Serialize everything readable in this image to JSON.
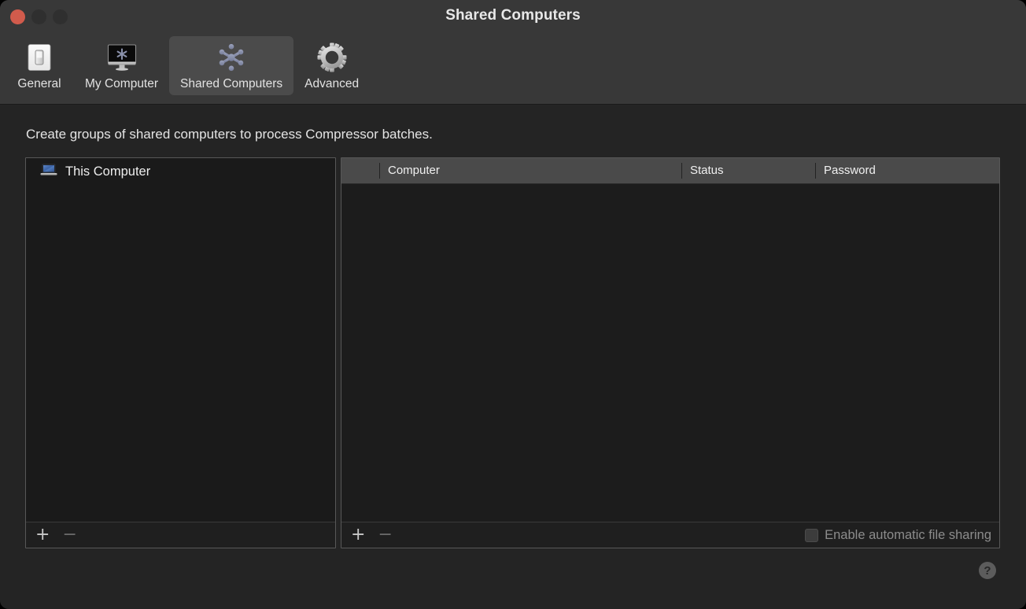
{
  "window": {
    "title": "Shared Computers",
    "traffic_lights": [
      {
        "name": "close",
        "color": "#d15b4c"
      },
      {
        "name": "minimize",
        "color": "#2f2f2f"
      },
      {
        "name": "zoom",
        "color": "#2f2f2f"
      }
    ]
  },
  "toolbar": {
    "tabs": [
      {
        "label": "General",
        "icon": "light-switch-icon",
        "selected": false
      },
      {
        "label": "My Computer",
        "icon": "display-asterisk-icon",
        "selected": false
      },
      {
        "label": "Shared Computers",
        "icon": "cluster-asterisk-icon",
        "selected": true
      },
      {
        "label": "Advanced",
        "icon": "gear-icon",
        "selected": false
      }
    ]
  },
  "main": {
    "description": "Create groups of shared computers to process Compressor batches.",
    "group_panel": {
      "rows": [
        {
          "label": "This Computer",
          "icon": "laptop-icon"
        }
      ],
      "footer": {
        "add_label": "+",
        "remove_label": "−",
        "add_enabled": true,
        "remove_enabled": false
      }
    },
    "computer_panel": {
      "columns": [
        {
          "key": "select",
          "label": ""
        },
        {
          "key": "computer",
          "label": "Computer"
        },
        {
          "key": "status",
          "label": "Status"
        },
        {
          "key": "password",
          "label": "Password"
        }
      ],
      "rows": [],
      "footer": {
        "add_label": "+",
        "remove_label": "−",
        "add_enabled": true,
        "remove_enabled": false,
        "checkbox_label": "Enable automatic file sharing",
        "checkbox_checked": false,
        "checkbox_enabled": false
      }
    },
    "help_label": "?"
  },
  "colors": {
    "titlebar_bg": "#383838",
    "content_bg": "#242424",
    "panel_bg": "#1a1a1a",
    "panel_border": "#585858",
    "table_header_bg": "#4a4a4a",
    "selected_tab_bg": "#4b4b4b",
    "accent_icon": "#8a91ab"
  }
}
